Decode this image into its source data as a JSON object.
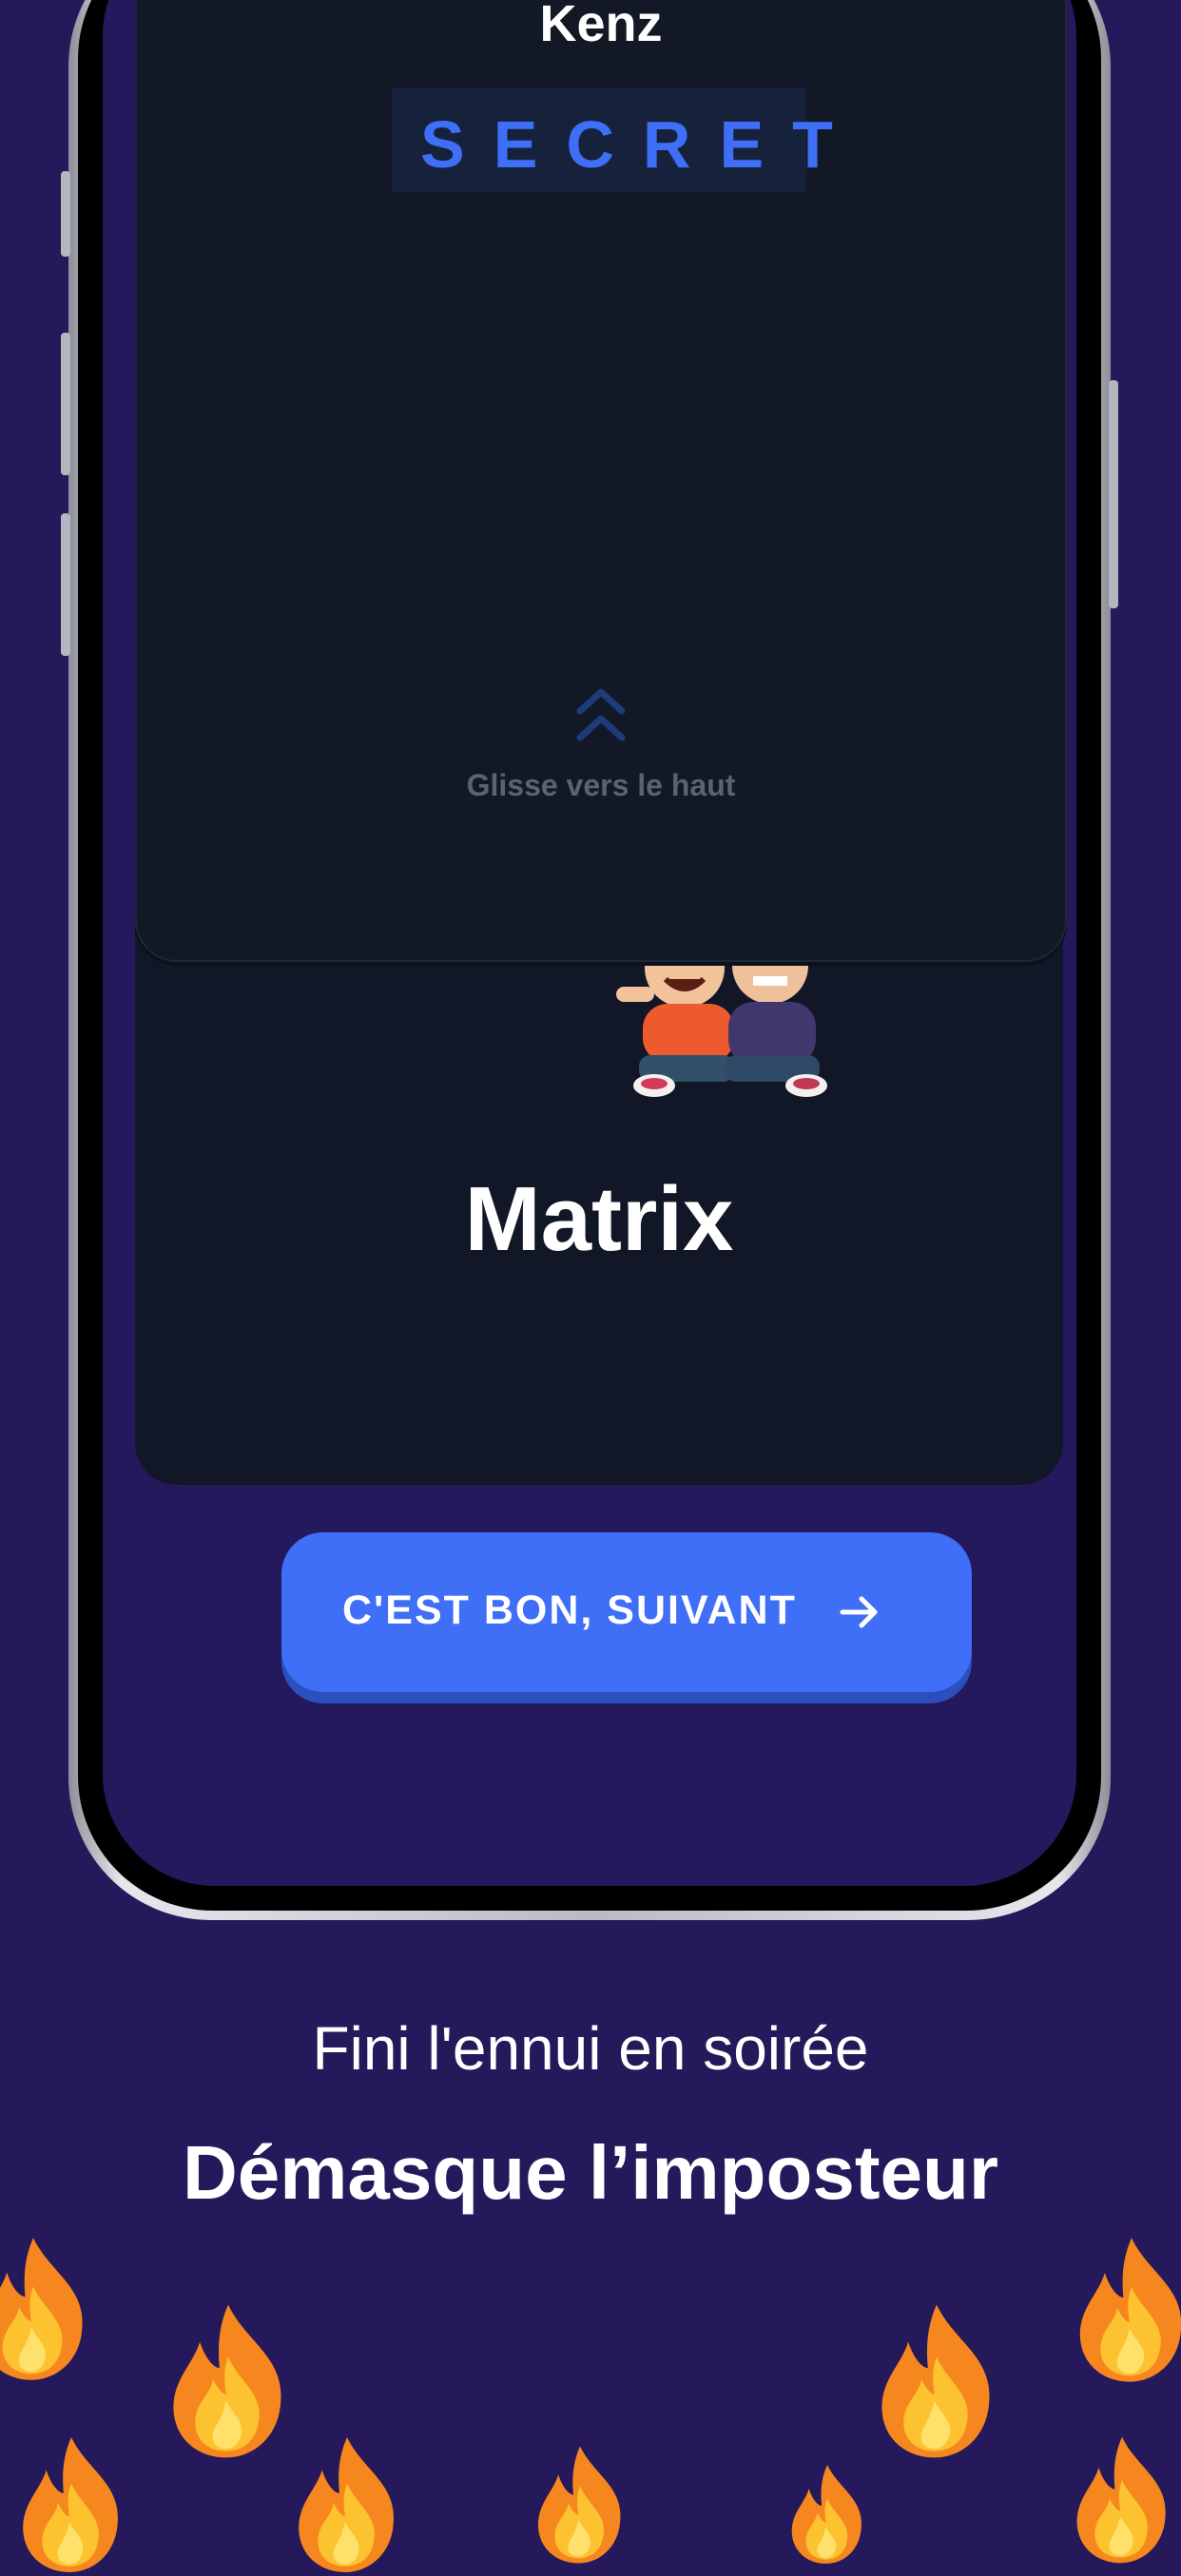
{
  "player": {
    "name": "Kenz"
  },
  "card": {
    "secret_label": "SECRET",
    "swipe_hint": "Glisse vers le haut",
    "secret_word": "Matrix"
  },
  "actions": {
    "next_label": "C'EST BON, SUIVANT"
  },
  "marketing": {
    "tagline": "Fini l'ennui en soirée",
    "headline": "Démasque l’imposteur"
  },
  "icons": {
    "swipe": "chevron-up-icon",
    "next": "arrow-right-icon",
    "decoration": "fire-icon"
  },
  "colors": {
    "background": "#25195c",
    "card": "#121826",
    "accent": "#3f6ef7",
    "secret": "#3e6ff6"
  }
}
